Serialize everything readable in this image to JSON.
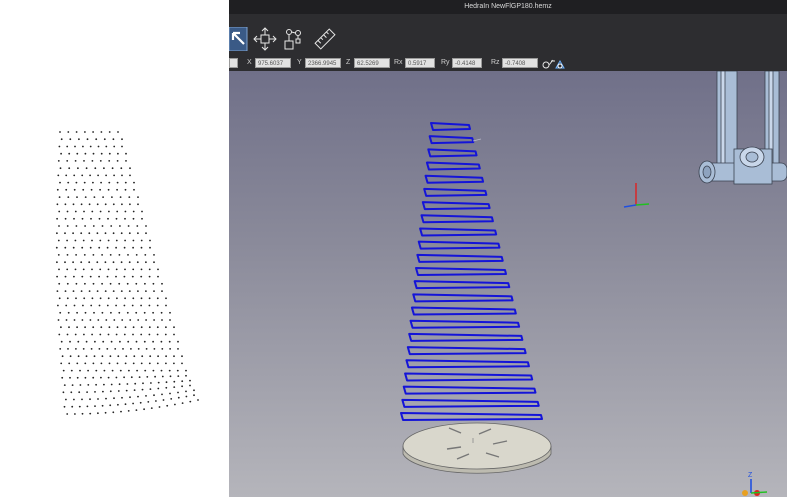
{
  "window": {
    "title": "HedraIn  NewFlGP180.hemz"
  },
  "toolbar": {
    "tools": [
      {
        "name": "select-arrow-icon",
        "active": true
      },
      {
        "name": "move-icon"
      },
      {
        "name": "robot-icon"
      },
      {
        "name": "ruler-icon"
      }
    ]
  },
  "coords": {
    "x_label": "X",
    "x_value": "975.6037",
    "y_label": "Y",
    "y_value": "2366.9945",
    "z_label": "Z",
    "z_value": "62.5269",
    "rx_label": "Rx",
    "rx_value": "0.5917",
    "ry_label": "Ry",
    "ry_value": "-0.4148",
    "rz_label": "Rz",
    "rz_value": "-0.7408"
  },
  "icons": [
    "lock-reset-icon",
    "pointcloud-icon",
    "toolpath-icon",
    "turntable-icon",
    "robot-arm-icon",
    "axis-triad-icon"
  ],
  "colors": {
    "toolpath": "#1414d8",
    "app_chrome": "#2d2d30",
    "viewport_top": "#707089",
    "viewport_bottom": "#b5b5bb",
    "turntable": "#d9d7cc",
    "robot": "#a9bdd6"
  }
}
